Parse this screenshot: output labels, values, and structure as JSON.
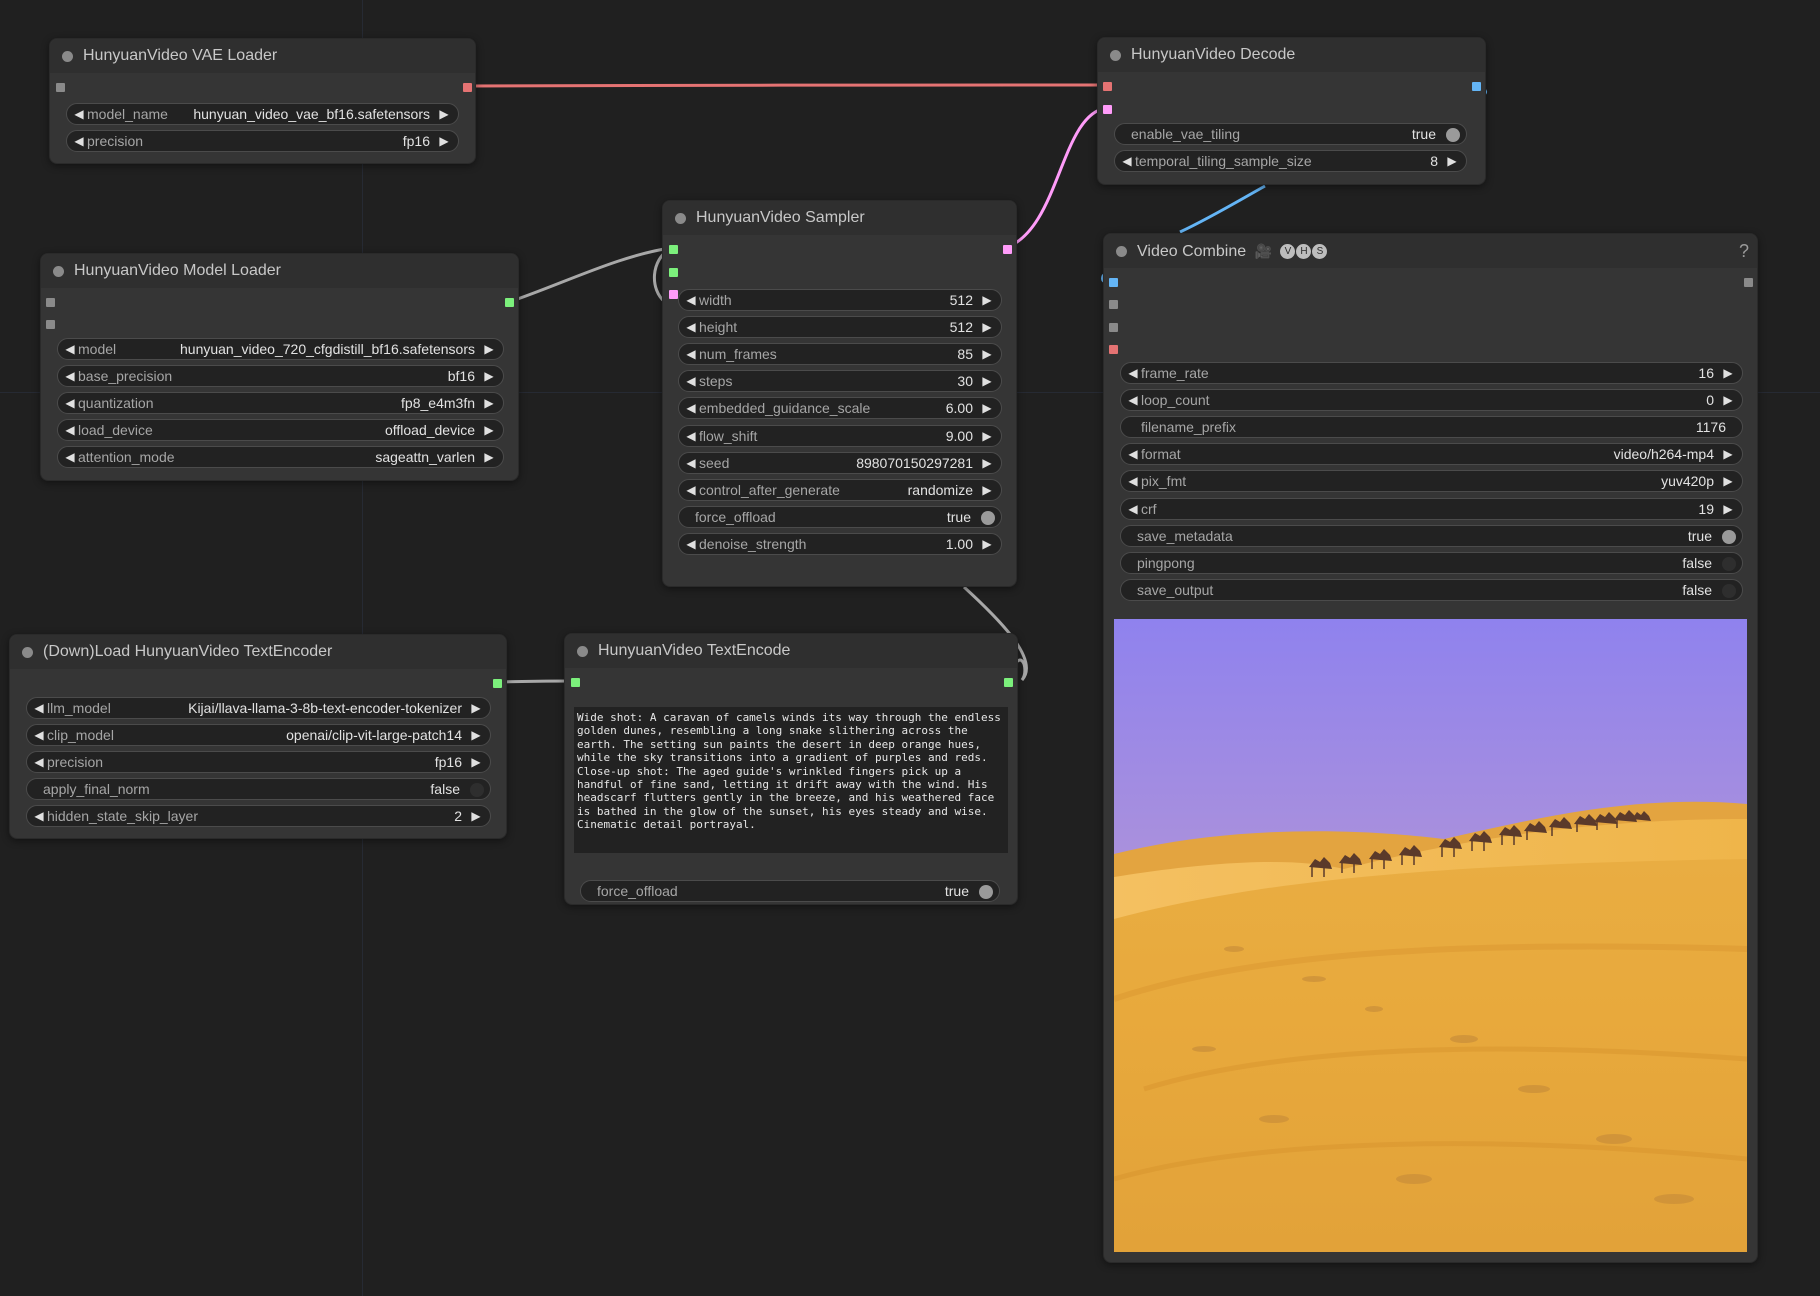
{
  "nodes": {
    "vae_loader": {
      "title": "HunyuanVideo VAE Loader",
      "widgets": [
        {
          "label": "model_name",
          "value": "hunyuan_video_vae_bf16.safetensors"
        },
        {
          "label": "precision",
          "value": "fp16"
        }
      ]
    },
    "decode": {
      "title": "HunyuanVideo Decode",
      "widgets": [
        {
          "label": "enable_vae_tiling",
          "value": "true"
        },
        {
          "label": "temporal_tiling_sample_size",
          "value": "8"
        }
      ]
    },
    "sampler": {
      "title": "HunyuanVideo Sampler",
      "widgets": [
        {
          "label": "width",
          "value": "512"
        },
        {
          "label": "height",
          "value": "512"
        },
        {
          "label": "num_frames",
          "value": "85"
        },
        {
          "label": "steps",
          "value": "30"
        },
        {
          "label": "embedded_guidance_scale",
          "value": "6.00"
        },
        {
          "label": "flow_shift",
          "value": "9.00"
        },
        {
          "label": "seed",
          "value": "898070150297281"
        },
        {
          "label": "control_after_generate",
          "value": "randomize"
        },
        {
          "label": "force_offload",
          "value": "true"
        },
        {
          "label": "denoise_strength",
          "value": "1.00"
        }
      ]
    },
    "model_loader": {
      "title": "HunyuanVideo Model Loader",
      "widgets": [
        {
          "label": "model",
          "value": "hunyuan_video_720_cfgdistill_bf16.safetensors"
        },
        {
          "label": "base_precision",
          "value": "bf16"
        },
        {
          "label": "quantization",
          "value": "fp8_e4m3fn"
        },
        {
          "label": "load_device",
          "value": "offload_device"
        },
        {
          "label": "attention_mode",
          "value": "sageattn_varlen"
        }
      ]
    },
    "video_combine": {
      "title": "Video Combine",
      "title_emoji": "🎥",
      "badges": [
        "V",
        "H",
        "S"
      ],
      "help": "?",
      "widgets": [
        {
          "label": "frame_rate",
          "value": "16"
        },
        {
          "label": "loop_count",
          "value": "0"
        },
        {
          "label": "filename_prefix",
          "value": "1176"
        },
        {
          "label": "format",
          "value": "video/h264-mp4"
        },
        {
          "label": "pix_fmt",
          "value": "yuv420p"
        },
        {
          "label": "crf",
          "value": "19"
        },
        {
          "label": "save_metadata",
          "value": "true"
        },
        {
          "label": "pingpong",
          "value": "false"
        },
        {
          "label": "save_output",
          "value": "false"
        }
      ]
    },
    "text_encoder_loader": {
      "title": "(Down)Load HunyuanVideo TextEncoder",
      "widgets": [
        {
          "label": "llm_model",
          "value": "Kijai/llava-llama-3-8b-text-encoder-tokenizer"
        },
        {
          "label": "clip_model",
          "value": "openai/clip-vit-large-patch14"
        },
        {
          "label": "precision",
          "value": "fp16"
        },
        {
          "label": "apply_final_norm",
          "value": "false"
        },
        {
          "label": "hidden_state_skip_layer",
          "value": "2"
        }
      ]
    },
    "text_encode": {
      "title": "HunyuanVideo TextEncode",
      "prompt": "Wide shot: A caravan of camels winds its way through the endless golden dunes, resembling a long snake slithering across the earth. The setting sun paints the desert in deep orange hues, while the sky transitions into a gradient of purples and reds. Close-up shot: The aged guide's wrinkled fingers pick up a handful of fine sand, letting it drift away with the wind. His headscarf flutters gently in the breeze, and his weathered face is bathed in the glow of the sunset, his eyes steady and wise. Cinematic detail portrayal.",
      "widgets": [
        {
          "label": "force_offload",
          "value": "true"
        }
      ]
    }
  },
  "colors": {
    "background": "#202020",
    "node_body": "#353535",
    "node_title": "#2f2f2f",
    "vae_link": "#e57373",
    "latent_link": "#ff9cf9",
    "model_link": "#a8a8a8",
    "image_link": "#64b5f6",
    "slot_green": "#7cf07c",
    "slot_pink": "#ff9cf9",
    "slot_red": "#e57373",
    "slot_blue": "#64b5f6",
    "slot_gray": "#8a8a8a"
  },
  "icons": {
    "widget_left": "triangle-left-icon",
    "widget_right": "triangle-right-icon",
    "toggle": "toggle-knob-icon",
    "help": "help-icon",
    "title_dot": "collapse-dot-icon"
  }
}
